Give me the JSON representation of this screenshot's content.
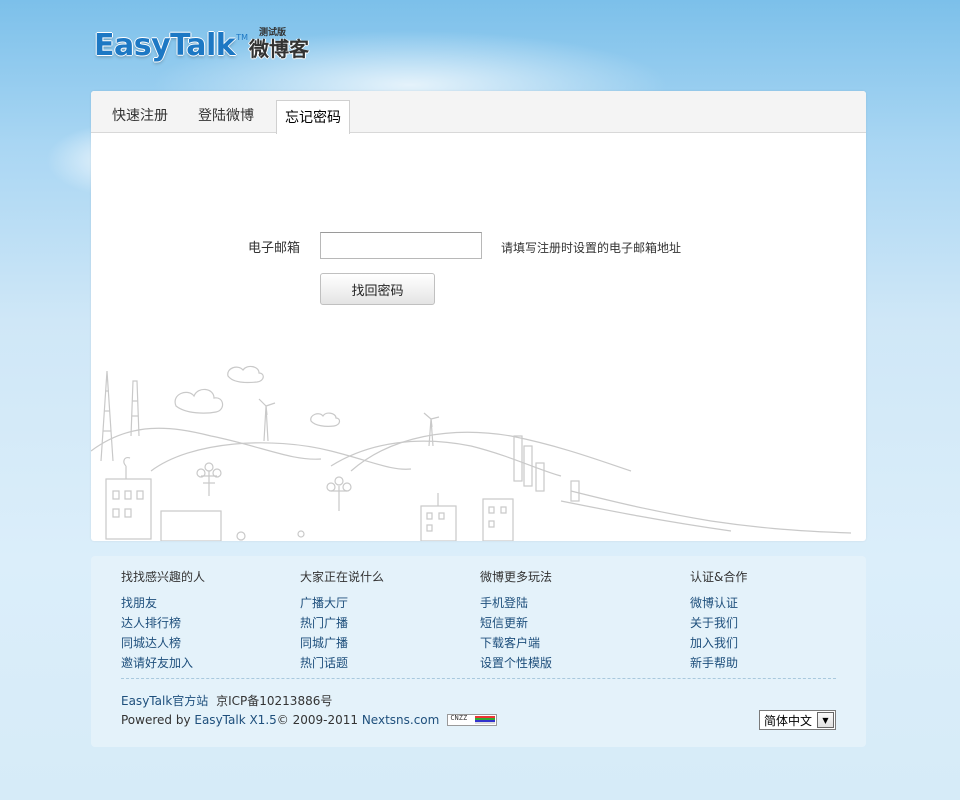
{
  "logo": {
    "brand": "EasyTalk",
    "tm": "TM",
    "cn_name": "微博客",
    "beta": "测试版"
  },
  "tabs": [
    {
      "label": "快速注册",
      "active": false
    },
    {
      "label": "登陆微博",
      "active": false
    },
    {
      "label": "忘记密码",
      "active": true
    }
  ],
  "form": {
    "email_label": "电子邮箱",
    "email_value": "",
    "email_hint": "请填写注册时设置的电子邮箱地址",
    "submit_label": "找回密码"
  },
  "footer": {
    "columns": [
      {
        "title": "找找感兴趣的人",
        "links": [
          "找朋友",
          "达人排行榜",
          "同城达人榜",
          "邀请好友加入"
        ]
      },
      {
        "title": "大家正在说什么",
        "links": [
          "广播大厅",
          "热门广播",
          "同城广播",
          "热门话题"
        ]
      },
      {
        "title": "微博更多玩法",
        "links": [
          "手机登陆",
          "短信更新",
          "下载客户端",
          "设置个性模版"
        ]
      },
      {
        "title": "认证&合作",
        "links": [
          "微博认证",
          "关于我们",
          "加入我们",
          "新手帮助"
        ]
      }
    ],
    "site_link": "EasyTalk官方站",
    "icp": "京ICP备10213886号",
    "powered_prefix": "Powered by ",
    "powered_link": "EasyTalk X1.5",
    "copyright": "© 2009-2011 ",
    "company_link": "Nextsns.com",
    "cnzz_badge": "CNZZ",
    "language": "简体中文"
  },
  "colors": {
    "brand_blue": "#1d78c4",
    "link_blue": "#1e4f7c",
    "footer_bg": "#e4f2fa"
  }
}
